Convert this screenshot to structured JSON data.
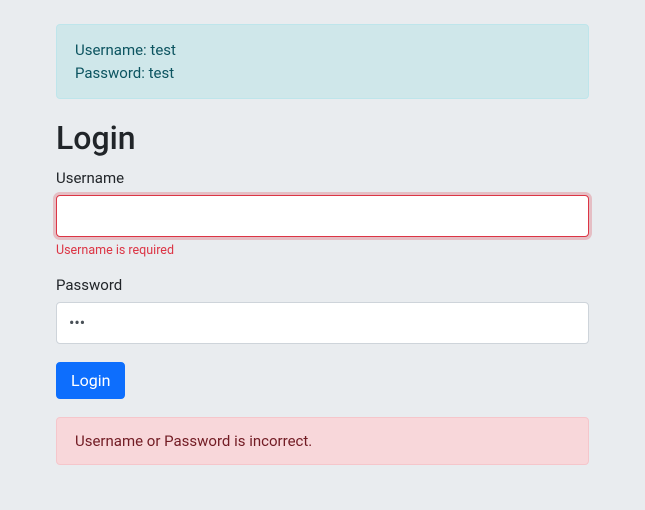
{
  "info_banner": {
    "line1": "Username: test",
    "line2": "Password: test"
  },
  "heading": "Login",
  "form": {
    "username": {
      "label": "Username",
      "value": "",
      "error": "Username is required"
    },
    "password": {
      "label": "Password",
      "value": "•••"
    },
    "submit_label": "Login"
  },
  "error_banner": "Username or Password is incorrect."
}
